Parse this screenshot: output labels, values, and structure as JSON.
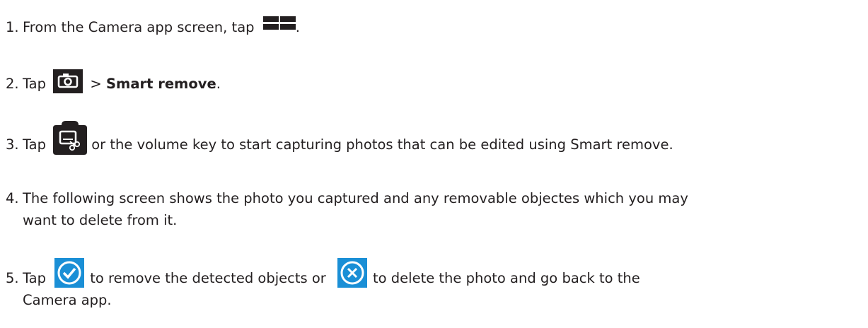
{
  "steps": [
    {
      "num": "1.",
      "text_before": "From the Camera app screen, tap",
      "text_after": ".",
      "icon": "grid-icon"
    },
    {
      "num": "2.",
      "text_before": "Tap",
      "separator": ">",
      "bold": "Smart remove",
      "text_after": ".",
      "icon": "camera-mode-icon"
    },
    {
      "num": "3.",
      "text_before": "Tap",
      "text_after": "or the volume key to start capturing photos that can be edited using Smart remove.",
      "icon": "smart-remove-shutter-icon"
    },
    {
      "num": "4.",
      "line1": "The following screen shows the photo you captured and any removable objectes which you may",
      "line2": "want to delete from it."
    },
    {
      "num": "5.",
      "text_before": "Tap",
      "text_middle": "to remove the detected objects or",
      "text_after": "to delete the photo and go back to the",
      "line2": "Camera app.",
      "icon_confirm": "checkmark-circle-icon",
      "icon_cancel": "x-circle-icon"
    }
  ],
  "colors": {
    "text": "#231f20",
    "icon_dark": "#231f20",
    "icon_blue": "#1a8fd6"
  }
}
